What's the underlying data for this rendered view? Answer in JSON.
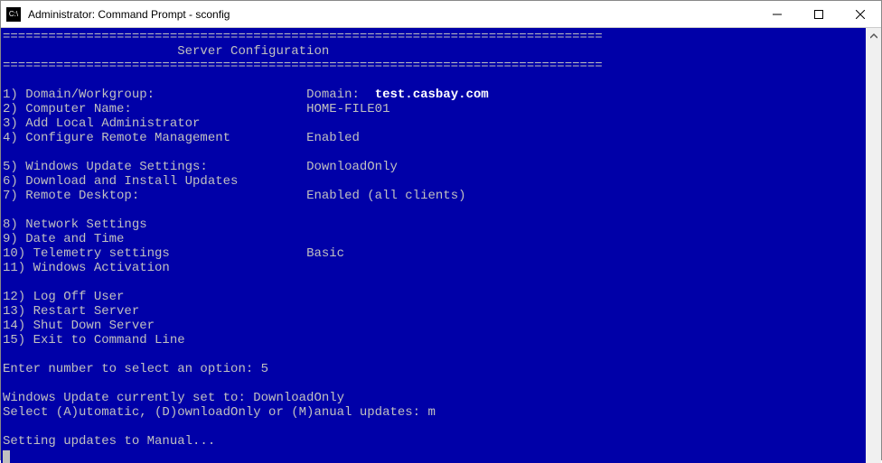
{
  "titlebar": {
    "icon_label": "C:\\",
    "title": "Administrator: Command Prompt - sconfig"
  },
  "separator": "===============================================================================",
  "header": "                       Server Configuration",
  "items": {
    "i1_label": "1) Domain/Workgroup:",
    "i1_value_prefix": "Domain:",
    "i1_value_bold": "test.casbay.com",
    "i2_label": "2) Computer Name:",
    "i2_value": "HOME-FILE01",
    "i3_label": "3) Add Local Administrator",
    "i4_label": "4) Configure Remote Management",
    "i4_value": "Enabled",
    "i5_label": "5) Windows Update Settings:",
    "i5_value": "DownloadOnly",
    "i6_label": "6) Download and Install Updates",
    "i7_label": "7) Remote Desktop:",
    "i7_value": "Enabled (all clients)",
    "i8_label": "8) Network Settings",
    "i9_label": "9) Date and Time",
    "i10_label": "10) Telemetry settings",
    "i10_value": "Basic",
    "i11_label": "11) Windows Activation",
    "i12_label": "12) Log Off User",
    "i13_label": "13) Restart Server",
    "i14_label": "14) Shut Down Server",
    "i15_label": "15) Exit to Command Line"
  },
  "prompt": {
    "select_option": "Enter number to select an option: 5",
    "wu_current": "Windows Update currently set to: DownloadOnly",
    "wu_select": "Select (A)utomatic, (D)ownloadOnly or (M)anual updates: m",
    "setting": "Setting updates to Manual..."
  },
  "pad": {
    "col_label": 40
  }
}
